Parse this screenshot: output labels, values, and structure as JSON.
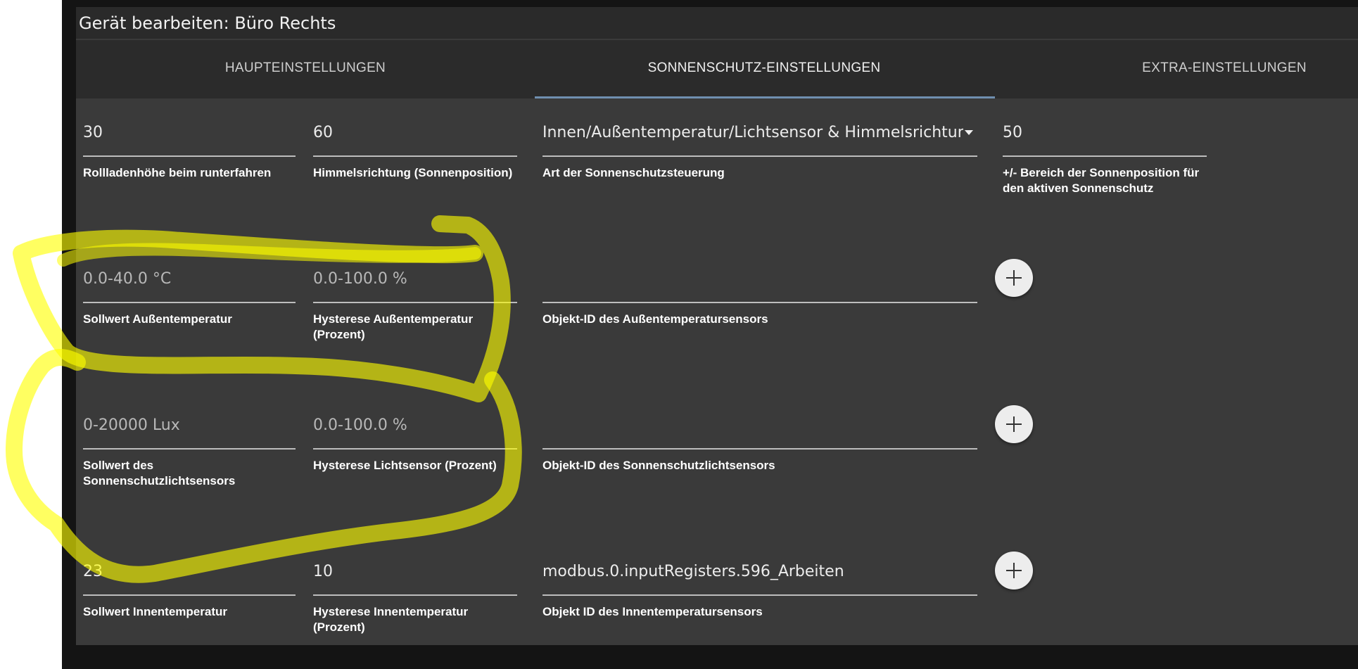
{
  "dialog": {
    "title": "Gerät bearbeiten: Büro Rechts"
  },
  "tabs": [
    {
      "label": "HAUPTEINSTELLUNGEN"
    },
    {
      "label": "SONNENSCHUTZ-EINSTELLUNGEN"
    },
    {
      "label": "EXTRA-EINSTELLUNGEN"
    }
  ],
  "rows": {
    "row1": {
      "height": {
        "value": "30",
        "label": "Rollladenhöhe beim runterfahren"
      },
      "direction": {
        "value": "60",
        "label": "Himmelsrichtung (Sonnenposition)"
      },
      "mode": {
        "value": "Innen/Außentemperatur/Lichtsensor & Himmelsrichtung",
        "label": "Art der Sonnenschutzsteuerung"
      },
      "range": {
        "value": "50",
        "label": "+/- Bereich der Sonnenposition für den aktiven Sonnenschutz"
      }
    },
    "row2": {
      "setpoint": {
        "placeholder": "0.0-40.0 °C",
        "label": "Sollwert Außentemperatur"
      },
      "hysteresis": {
        "placeholder": "0.0-100.0 %",
        "label": "Hysterese Außentemperatur (Prozent)"
      },
      "object": {
        "value": "",
        "label": "Objekt-ID des Außentemperatursensors"
      }
    },
    "row3": {
      "setpoint": {
        "placeholder": "0-20000 Lux",
        "label": "Sollwert des Sonnenschutzlichtsensors"
      },
      "hysteresis": {
        "placeholder": "0.0-100.0 %",
        "label": "Hysterese Lichtsensor (Prozent)"
      },
      "object": {
        "value": "",
        "label": "Objekt-ID des Sonnenschutzlichtsensors"
      }
    },
    "row4": {
      "setpoint": {
        "value": "23",
        "label": "Sollwert Innentemperatur"
      },
      "hysteresis": {
        "value": "10",
        "label": "Hysterese Innentemperatur (Prozent)"
      },
      "object": {
        "value": "modbus.0.inputRegisters.596_Arbeiten",
        "label": "Objekt ID des Innentemperatursensors"
      }
    }
  },
  "icons": {
    "add": "plus-icon",
    "select": "caret-down-icon"
  },
  "colors": {
    "highlight": "#ffff00",
    "tab_indicator": "#6f8fb0",
    "dialog_bg": "#3a3a3a"
  }
}
